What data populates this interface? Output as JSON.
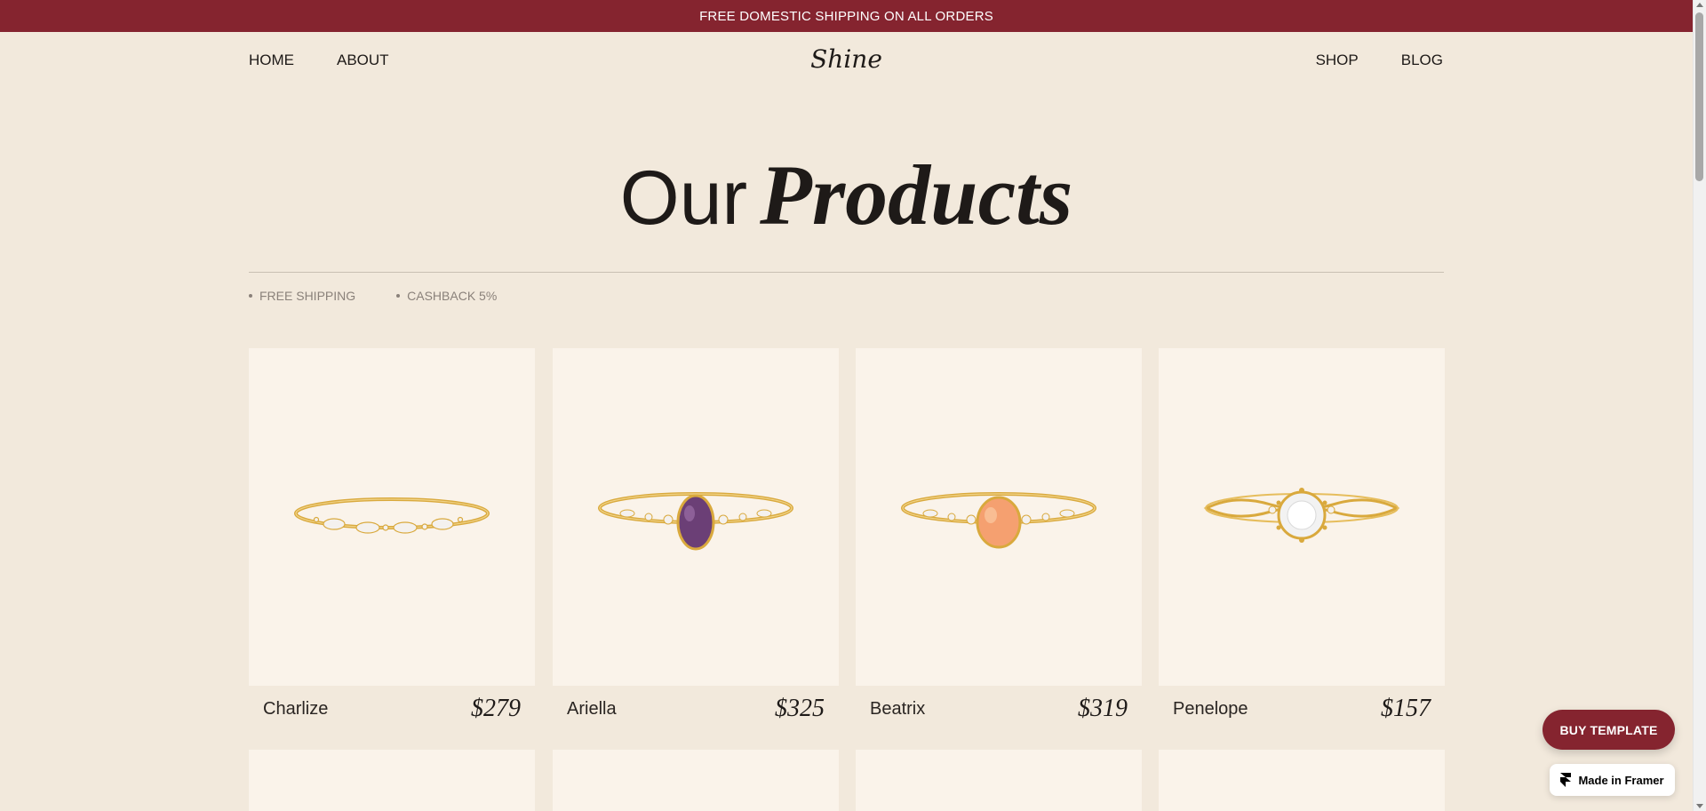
{
  "announcement": "FREE DOMESTIC SHIPPING ON ALL ORDERS",
  "nav": {
    "left": [
      "HOME",
      "ABOUT"
    ],
    "right": [
      "SHOP",
      "BLOG"
    ],
    "logo": "Shine"
  },
  "hero": {
    "title_plain": "Our",
    "title_italic": "Products"
  },
  "features": [
    "FREE SHIPPING",
    "CASHBACK 5%"
  ],
  "products": [
    {
      "name": "Charlize",
      "price": "$279",
      "stone": "marquise-band",
      "stone_color": "#f4f1ee"
    },
    {
      "name": "Ariella",
      "price": "$325",
      "stone": "oval",
      "stone_color": "#6b3f76"
    },
    {
      "name": "Beatrix",
      "price": "$319",
      "stone": "oval",
      "stone_color": "#f5a070"
    },
    {
      "name": "Penelope",
      "price": "$157",
      "stone": "round",
      "stone_color": "#f2f2f2"
    }
  ],
  "buy_template": "BUY TEMPLATE",
  "made_in_framer": "Made in Framer",
  "colors": {
    "brand": "#85242f",
    "background": "#f2e9dc",
    "card": "#faf3ea",
    "gold": "#d9a93d"
  }
}
